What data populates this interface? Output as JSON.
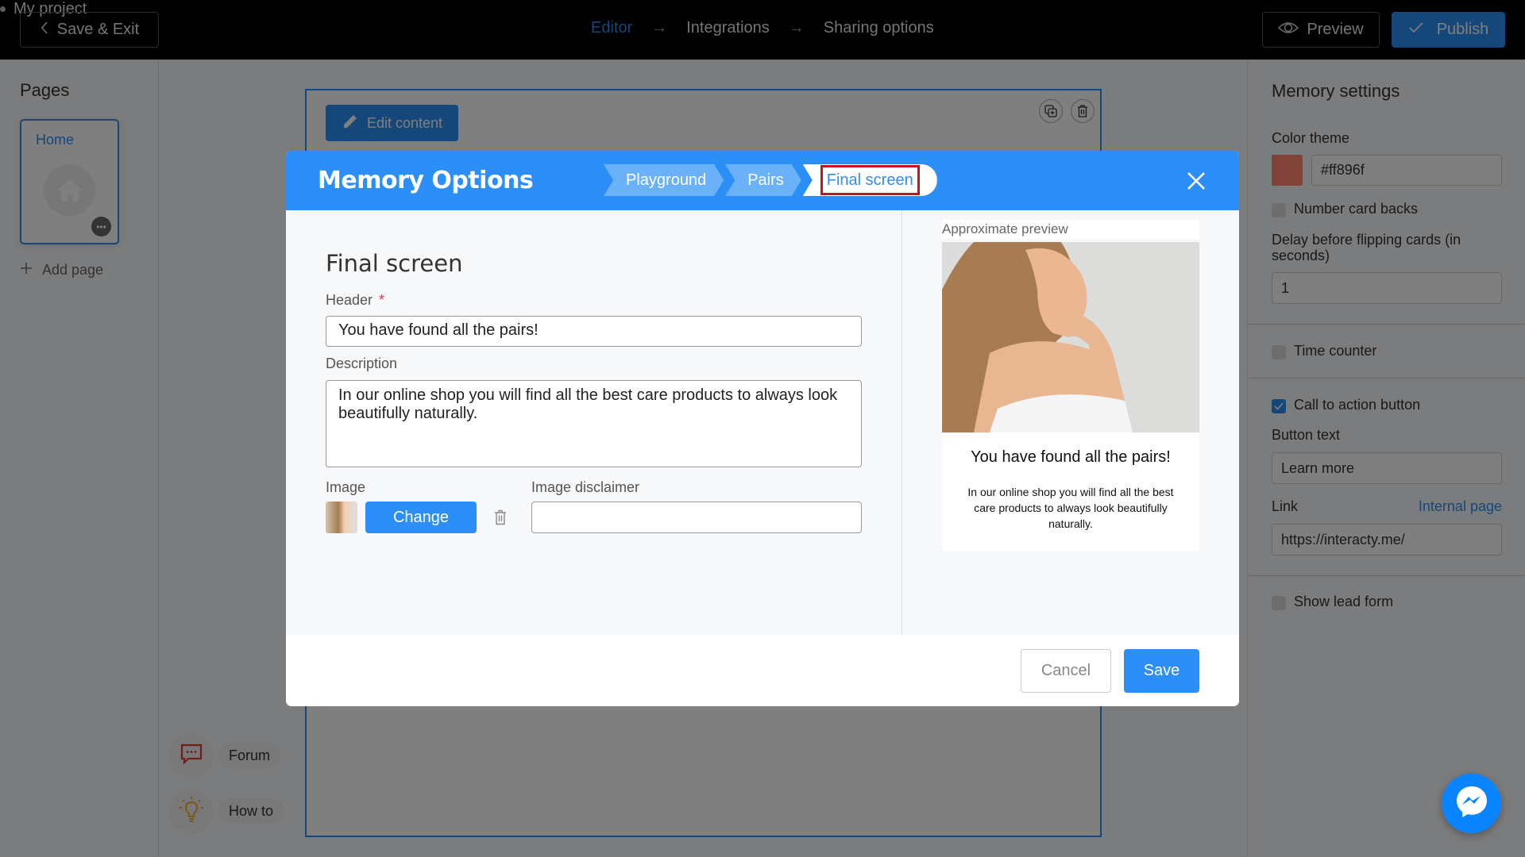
{
  "topbar": {
    "save_exit_label": "Save & Exit",
    "project_name": "My project",
    "steps": [
      {
        "label": "Editor",
        "active": true
      },
      {
        "label": "Integrations",
        "active": false
      },
      {
        "label": "Sharing options",
        "active": false
      }
    ],
    "arrow_glyph": "→",
    "preview_label": "Preview",
    "publish_label": "Publish"
  },
  "sidebar": {
    "title": "Pages",
    "pages": [
      {
        "label": "Home"
      }
    ],
    "add_page_label": "Add page"
  },
  "canvas": {
    "edit_content_label": "Edit content"
  },
  "help": {
    "forum_label": "Forum",
    "howto_label": "How to"
  },
  "settings": {
    "title": "Memory settings",
    "color_theme_label": "Color theme",
    "color_value": "#ff896f",
    "number_card_backs_label": "Number card backs",
    "number_card_backs_checked": false,
    "delay_label": "Delay before flipping cards (in seconds)",
    "delay_value": "1",
    "time_counter_label": "Time counter",
    "time_counter_checked": false,
    "cta_label": "Call to action button",
    "cta_checked": true,
    "button_text_label": "Button text",
    "button_text_value": "Learn more",
    "link_label": "Link",
    "internal_page_label": "Internal page",
    "link_value": "https://interacty.me/",
    "lead_form_label": "Show lead form",
    "lead_form_checked": false
  },
  "modal": {
    "title": "Memory Options",
    "breadcrumbs": [
      "Playground",
      "Pairs",
      "Final screen"
    ],
    "active_breadcrumb": "Final screen",
    "form_title": "Final screen",
    "header_label": "Header",
    "required_mark": "*",
    "header_value": "You have found all the pairs!",
    "description_label": "Description",
    "description_value": "In our online shop you will find all the best care products to always look beautifully naturally.",
    "image_label": "Image",
    "change_label": "Change",
    "image_disclaimer_label": "Image disclaimer",
    "image_disclaimer_value": "",
    "preview_label": "Approximate preview",
    "preview_header": "You have found all the pairs!",
    "preview_description": "In our online shop you will find all the best care products to always look beautifully naturally.",
    "cancel_label": "Cancel",
    "save_label": "Save"
  },
  "colors": {
    "accent": "#2b8ff7",
    "highlight_border": "#c0161e",
    "required": "#e53935",
    "theme_swatch": "#ff896f"
  }
}
